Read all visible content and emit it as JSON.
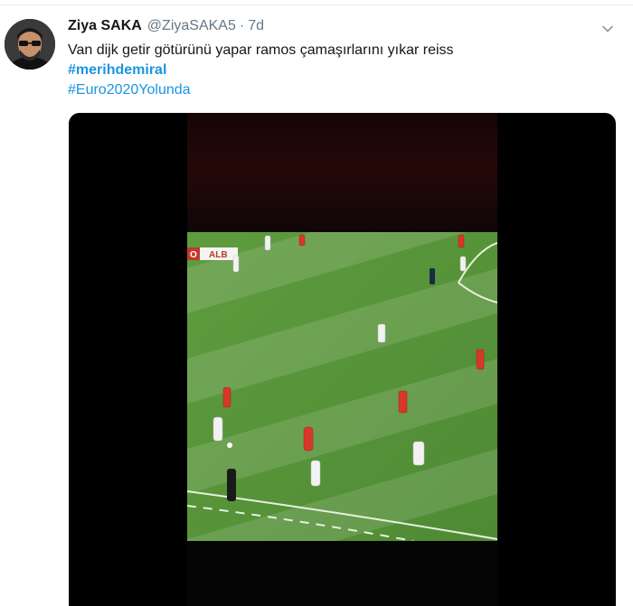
{
  "user": {
    "display_name": "Ziya SAKA",
    "handle": "@ZiyaSAKA5",
    "separator": "·",
    "time": "7d"
  },
  "tweet": {
    "text": "Van dijk getir götürünü yapar ramos çamaşırlarını yıkar reiss",
    "hashtags": [
      "#merihdemiral",
      "#Euro2020Yolunda"
    ]
  },
  "media": {
    "type": "video",
    "scoreboard": {
      "home_fragment": "O",
      "away": "ALB"
    }
  },
  "icons": {
    "menu": "chevron-down-icon",
    "avatar": "profile-photo"
  },
  "colors": {
    "link": "#1b95e0",
    "secondary_text": "#657786",
    "pitch_green": "#5e9a3c",
    "home_kit": "#d8372a",
    "away_kit": "#f2f2f2"
  }
}
